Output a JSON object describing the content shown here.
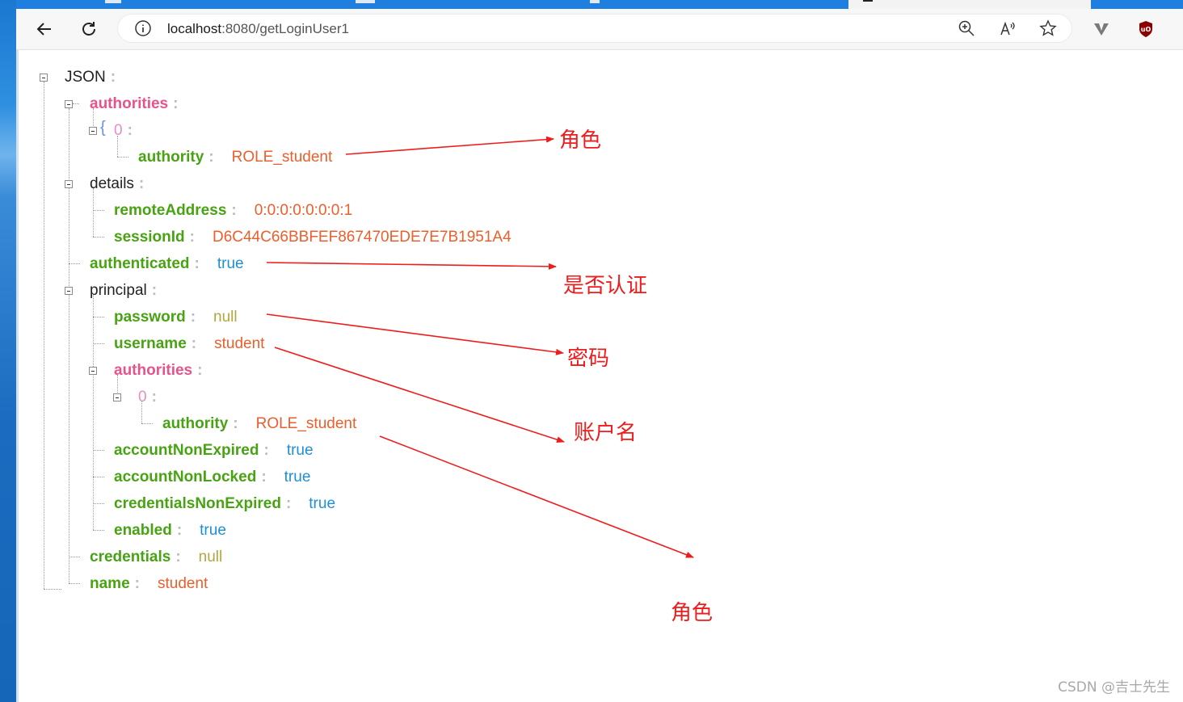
{
  "browser": {
    "url_host": "localhost",
    "url_path": ":8080/getLoginUser1",
    "icons": [
      "back-arrow-icon",
      "refresh-icon",
      "info-icon",
      "zoom-icon",
      "read-aloud-icon",
      "favorite-star-icon",
      "extension-v-icon",
      "ublock-shield-icon"
    ]
  },
  "json_tree": {
    "root_key": "JSON",
    "authorities_key": "authorities",
    "auth_index": "0",
    "authority_key": "authority",
    "authority_value": "ROLE_student",
    "details_key": "details",
    "remote_key": "remoteAddress",
    "remote_value": "0:0:0:0:0:0:0:1",
    "session_key": "sessionId",
    "session_value": "D6C44C66BBFEF867470EDE7E7B1951A4",
    "authenticated_key": "authenticated",
    "authenticated_value": "true",
    "principal_key": "principal",
    "password_key": "password",
    "password_value": "null",
    "username_key": "username",
    "username_value": "student",
    "p_authorities_key": "authorities",
    "p_auth_index": "0",
    "p_authority_key": "authority",
    "p_authority_value": "ROLE_student",
    "ane_key": "accountNonExpired",
    "ane_value": "true",
    "anl_key": "accountNonLocked",
    "anl_value": "true",
    "cne_key": "credentialsNonExpired",
    "cne_value": "true",
    "enabled_key": "enabled",
    "enabled_value": "true",
    "credentials_key": "credentials",
    "credentials_value": "null",
    "name_key": "name",
    "name_value": "student",
    "colon": ":"
  },
  "annotations": {
    "role_1": "角色",
    "authenticated": "是否认证",
    "password": "密码",
    "username": "账户名",
    "role_2": "角色"
  },
  "colors": {
    "key_green": "#48a312",
    "key_pink": "#e8538a",
    "string_value": "#ec5e2c",
    "bool_value": "#1e8fd4",
    "null_value": "#b2a740",
    "annotation_red": "#ee1c1c"
  },
  "watermark": "CSDN @吉士先生"
}
